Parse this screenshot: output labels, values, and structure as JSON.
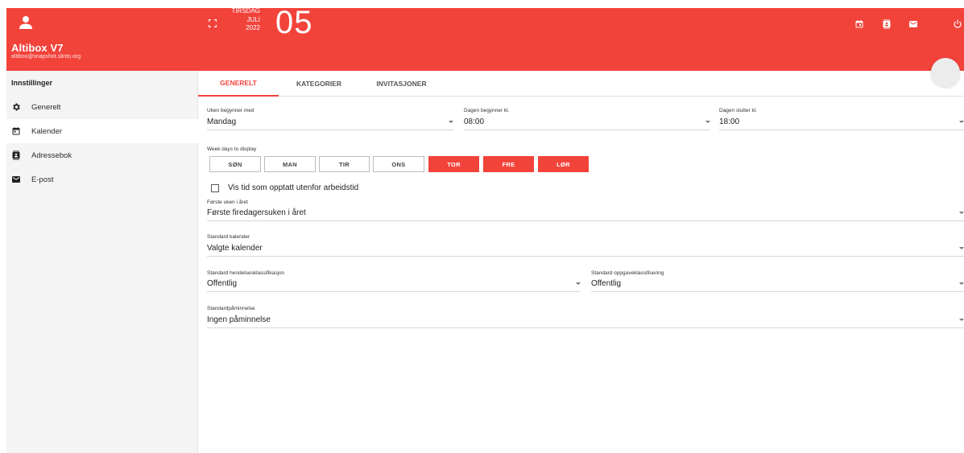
{
  "sidebar": {
    "title": "Altibox V7",
    "email": "altibox@snapshot.slinto.org",
    "section": "Innstillinger",
    "items": [
      {
        "label": "Generelt",
        "icon": "gear-icon"
      },
      {
        "label": "Kalender",
        "icon": "calendar-icon"
      },
      {
        "label": "Adressebok",
        "icon": "contacts-icon"
      },
      {
        "label": "E-post",
        "icon": "mail-icon"
      }
    ]
  },
  "topbar": {
    "weekday": "TIRSDAG",
    "month": "JULI",
    "year": "2022",
    "day": "05"
  },
  "tabs": [
    "GENERELT",
    "KATEGORIER",
    "INVITASJONER"
  ],
  "form": {
    "week_start": {
      "label": "Uken begynner med",
      "value": "Mandag"
    },
    "day_start": {
      "label": "Dagen begynner kl.",
      "value": "08:00"
    },
    "day_end": {
      "label": "Dagen slutter kl.",
      "value": "18:00"
    },
    "weekdays": {
      "label": "Week days to display",
      "days": [
        {
          "label": "SØN",
          "selected": false
        },
        {
          "label": "MAN",
          "selected": false
        },
        {
          "label": "TIR",
          "selected": false
        },
        {
          "label": "ONS",
          "selected": false
        },
        {
          "label": "TOR",
          "selected": true
        },
        {
          "label": "FRE",
          "selected": true
        },
        {
          "label": "LØR",
          "selected": true
        }
      ]
    },
    "show_busy": {
      "label": "Vis tid som opptatt utenfor arbeidstid",
      "checked": false
    },
    "first_week": {
      "label": "Første uken i året",
      "value": "Første firedagersuken i året"
    },
    "default_calendar": {
      "label": "Standard kalender",
      "value": "Valgte kalender"
    },
    "event_class": {
      "label": "Standard hendelsesklassifikasjon",
      "value": "Offentlig"
    },
    "task_class": {
      "label": "Standard oppgaveklassifisering",
      "value": "Offentlig"
    },
    "reminder": {
      "label": "Standardpåminnelse",
      "value": "Ingen påminnelse"
    }
  },
  "colors": {
    "accent": "#f2433b",
    "sidebar_bg": "#f4f4f4"
  }
}
